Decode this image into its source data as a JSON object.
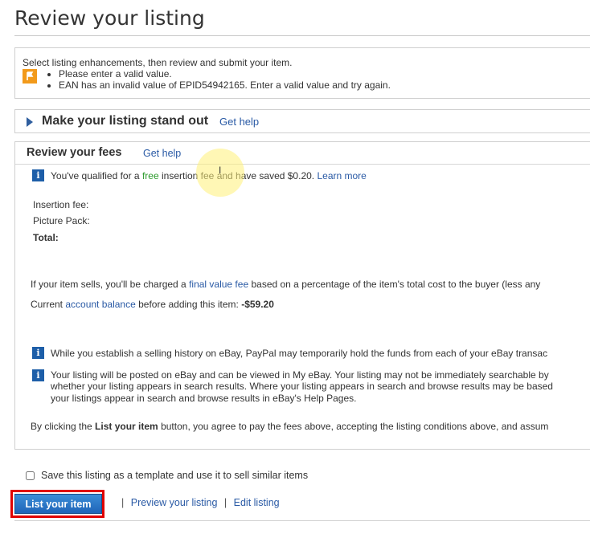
{
  "page": {
    "title": "Review your listing"
  },
  "alert": {
    "intro": "Select listing enhancements, then review and submit your item.",
    "errors": [
      "Please enter a valid value.",
      "EAN has an invalid value of EPID54942165. Enter a valid value and try again."
    ],
    "icon": "warning-flag-icon",
    "icon_color": "#f29a1b"
  },
  "standout": {
    "heading": "Make your listing stand out",
    "help": "Get help"
  },
  "fees": {
    "heading": "Review your fees",
    "help": "Get help",
    "qualified": {
      "pre": "You've qualified for a",
      "free": "free",
      "post": "insertion fee and have saved $0.20.",
      "learn_more": "Learn more"
    },
    "rows": {
      "insertion_fee": "Insertion fee:",
      "picture_pack": "Picture Pack:",
      "total": "Total:"
    },
    "final_value": {
      "pre": "If your item sells, you'll be charged a",
      "link": "final value fee",
      "post": "based on a percentage of the item's total cost to the buyer (less any"
    },
    "balance": {
      "pre": "Current",
      "link": "account balance",
      "post": "before adding this item:",
      "amount": "-$59.20"
    },
    "notice_paypal": "While you establish a selling history on eBay, PayPal may temporarily hold the funds from each of your eBay transac",
    "notice_listing": [
      "Your listing will be posted on eBay and can be viewed in My eBay. Your listing may not be immediately searchable by",
      "whether your listing appears in search results. Where your listing appears in search and browse results may be based",
      "your listings appear in search and browse results in eBay's Help Pages."
    ],
    "agree": {
      "pre": "By clicking the",
      "button_name": "List your item",
      "post": "button, you agree to pay the fees above, accepting the listing conditions above, and assum"
    }
  },
  "save_template": {
    "label": "Save this listing as a template and use it to sell similar items",
    "checked": false
  },
  "actions": {
    "list_button": "List your item",
    "separator": "|",
    "preview": "Preview your listing",
    "edit": "Edit listing"
  },
  "colors": {
    "link": "#2a5aa5",
    "free": "#2b9a2b",
    "button": "#1f64b8",
    "outline": "#e00000"
  }
}
